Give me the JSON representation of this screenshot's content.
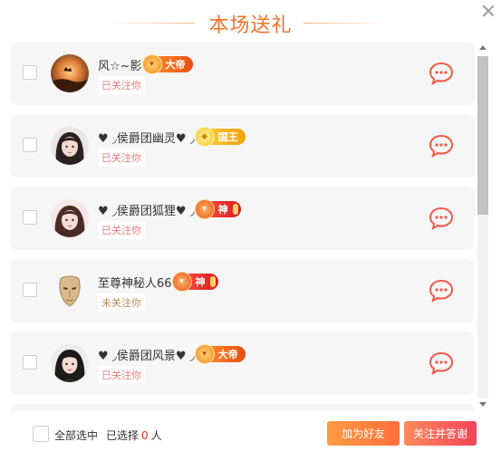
{
  "title": "本场送礼",
  "users": [
    {
      "name": "风☆~影",
      "badge_label": "大帝",
      "badge_type": "emperor",
      "status": "已关注你",
      "followed": true,
      "avatar": "sunset"
    },
    {
      "name": "♥ ◞侯爵团幽灵♥ ◞",
      "badge_label": "国王",
      "badge_type": "king",
      "status": "已关注你",
      "followed": true,
      "avatar": "girl1"
    },
    {
      "name": "♥ ◞侯爵团狐狸♥ ◞",
      "badge_label": "神",
      "badge_type": "god",
      "status": "已关注你",
      "followed": true,
      "avatar": "girl2"
    },
    {
      "name": "至尊神秘人66",
      "badge_label": "神",
      "badge_type": "god",
      "status": "未关注你",
      "followed": false,
      "avatar": "mask"
    },
    {
      "name": "♥ ◞侯爵团风景♥ ◞",
      "badge_label": "大帝",
      "badge_type": "emperor",
      "status": "已关注你",
      "followed": true,
      "avatar": "girl3"
    }
  ],
  "footer": {
    "select_all_label": "全部选中",
    "selected_prefix": "已选择",
    "selected_count": "0",
    "selected_suffix": "人",
    "add_friend_label": "加为好友",
    "follow_thank_label": "关注并答谢"
  },
  "colors": {
    "accent": "#f0732a",
    "count_red": "#e8321c",
    "chat_icon": "#f05a4a"
  }
}
